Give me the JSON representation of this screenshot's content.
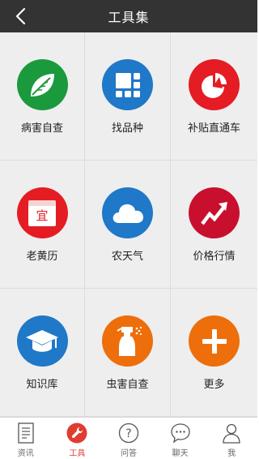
{
  "header": {
    "title": "工具集"
  },
  "tools": [
    {
      "label": "病害自查",
      "icon": "leaf-icon",
      "color": "#1a9a3c"
    },
    {
      "label": "找品种",
      "icon": "grid-blocks-icon",
      "color": "#1f78c8"
    },
    {
      "label": "补贴直通车",
      "icon": "pie-chart-icon",
      "color": "#e51c23"
    },
    {
      "label": "老黄历",
      "icon": "calendar-icon",
      "color": "#e51c23"
    },
    {
      "label": "农天气",
      "icon": "cloud-icon",
      "color": "#1f78c8"
    },
    {
      "label": "价格行情",
      "icon": "trend-arrow-icon",
      "color": "#c8102e"
    },
    {
      "label": "知识库",
      "icon": "graduation-cap-icon",
      "color": "#1f78c8"
    },
    {
      "label": "虫害自查",
      "icon": "spray-bottle-icon",
      "color": "#ee6e0b"
    },
    {
      "label": "更多",
      "icon": "plus-icon",
      "color": "#ee6e0b"
    }
  ],
  "calendar_glyph": "宜",
  "tabbar": {
    "items": [
      {
        "label": "资讯",
        "icon": "news-icon"
      },
      {
        "label": "工具",
        "icon": "wrench-icon",
        "active": true
      },
      {
        "label": "问答",
        "icon": "question-icon"
      },
      {
        "label": "聊天",
        "icon": "chat-bubble-icon"
      },
      {
        "label": "我",
        "icon": "person-icon"
      }
    ],
    "active_color": "#e03c31"
  }
}
